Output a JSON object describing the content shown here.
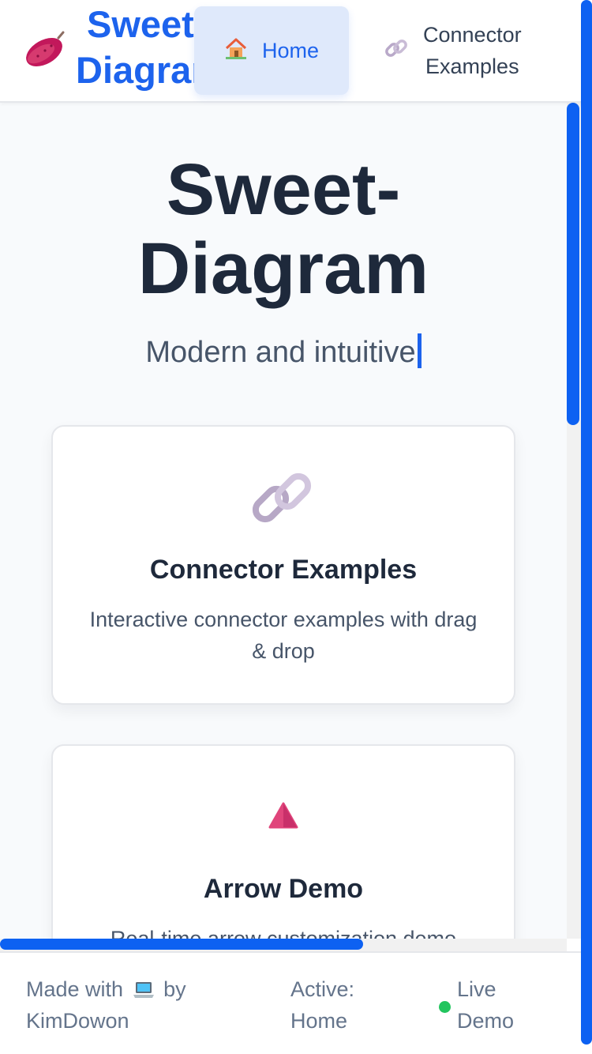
{
  "header": {
    "brand_line1": "Sweet-",
    "brand_line2": "Diagram",
    "nav": {
      "home_label": "Home",
      "connector_line1": "Connector",
      "connector_line2": "Examples"
    }
  },
  "hero": {
    "title_line1": "Sweet-",
    "title_line2": "Diagram",
    "subtitle": "Modern and intuitive"
  },
  "cards": [
    {
      "icon": "link-icon",
      "title": "Connector Examples",
      "description": "Interactive connector examples with drag & drop"
    },
    {
      "icon": "triangle-icon",
      "title": "Arrow Demo",
      "description": "Real-time arrow customization demo"
    }
  ],
  "footer": {
    "made_prefix": "Made with",
    "made_suffix": "by",
    "author": "KimDowon",
    "active_label": "Active:",
    "active_value": "Home",
    "live_line1": "Live",
    "live_line2": "Demo"
  },
  "colors": {
    "accent": "#1d63ed",
    "scrollbar": "#0d61f2",
    "heading": "#1e293b",
    "muted": "#475569",
    "live": "#22c55e"
  },
  "scroll": {
    "vertical_position_fraction": 0,
    "horizontal_position_fraction": 0
  }
}
